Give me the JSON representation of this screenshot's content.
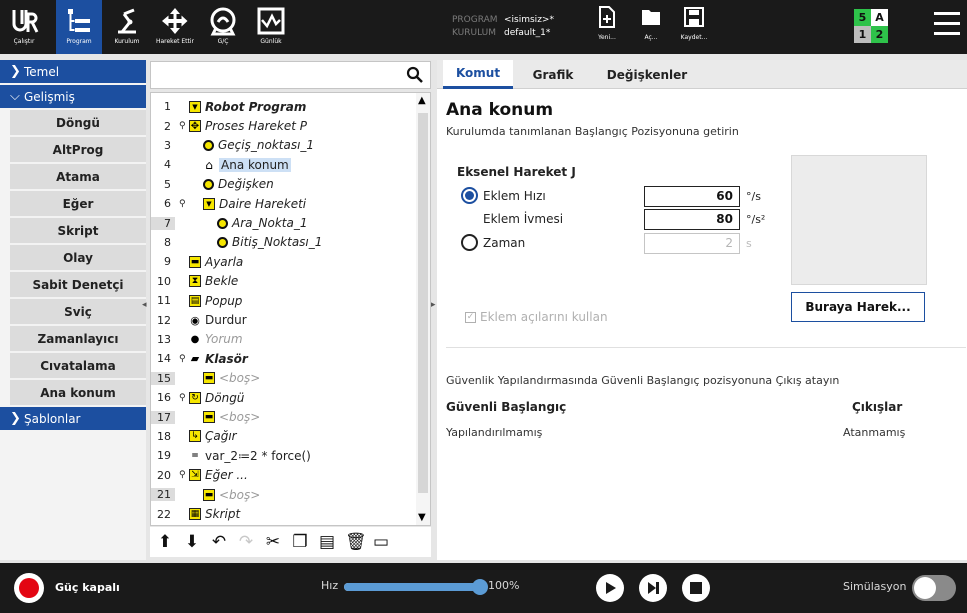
{
  "header": {
    "nav": [
      {
        "label": "Çalıştır",
        "icon": "run-icon"
      },
      {
        "label": "Program",
        "icon": "program-icon"
      },
      {
        "label": "Kurulum",
        "icon": "installation-icon"
      },
      {
        "label": "Hareket Ettir",
        "icon": "move-icon"
      },
      {
        "label": "G/Ç",
        "icon": "io-icon"
      },
      {
        "label": "Günlük",
        "icon": "log-icon"
      }
    ],
    "program_key": "PROGRAM",
    "program_value": "<isimsiz>*",
    "installation_key": "KURULUM",
    "installation_value": "default_1*",
    "file_buttons": [
      {
        "label": "Yeni...",
        "icon": "new-file-icon"
      },
      {
        "label": "Aç...",
        "icon": "open-folder-icon"
      },
      {
        "label": "Kaydet...",
        "icon": "save-icon"
      }
    ],
    "speed_grid": [
      "5",
      "A",
      "1",
      "2"
    ],
    "accent": "#1c4fa0"
  },
  "sidebar": {
    "basic_label": "Temel",
    "advanced_label": "Gelişmiş",
    "templates_label": "Şablonlar",
    "items": [
      "Döngü",
      "AltProg",
      "Atama",
      "Eğer",
      "Skript",
      "Olay",
      "Sabit Denetçi",
      "Sviç",
      "Zamanlayıcı",
      "Cıvatalama",
      "Ana konum"
    ]
  },
  "tree": {
    "rows": [
      {
        "n": "1",
        "text": "Robot Program",
        "icon": "yellow-triangle",
        "indent": 0,
        "pin": false,
        "style": "bold"
      },
      {
        "n": "2",
        "text": "Proses Hareket P",
        "icon": "move-cross",
        "indent": 0,
        "pin": true,
        "style": "italic"
      },
      {
        "n": "3",
        "text": "Geçiş_noktası_1",
        "icon": "waypoint",
        "indent": 1,
        "pin": false,
        "style": "italic"
      },
      {
        "n": "4",
        "text": "Ana konum",
        "icon": "home",
        "indent": 1,
        "pin": false,
        "style": "selected"
      },
      {
        "n": "5",
        "text": "Değişken",
        "icon": "waypoint",
        "indent": 1,
        "pin": false,
        "style": "italic"
      },
      {
        "n": "6",
        "text": "Daire Hareketi",
        "icon": "yellow-triangle",
        "indent": 1,
        "pin": true,
        "style": "italic"
      },
      {
        "n": "7",
        "text": "Ara_Nokta_1",
        "icon": "waypoint",
        "indent": 2,
        "pin": false,
        "style": "italic"
      },
      {
        "n": "8",
        "text": "Bitiş_Noktası_1",
        "icon": "waypoint",
        "indent": 2,
        "pin": false,
        "style": "italic"
      },
      {
        "n": "9",
        "text": "Ayarla",
        "icon": "yellow-dash",
        "indent": 0,
        "pin": false,
        "style": "italic"
      },
      {
        "n": "10",
        "text": "Bekle",
        "icon": "hourglass",
        "indent": 0,
        "pin": false,
        "style": "italic"
      },
      {
        "n": "11",
        "text": "Popup",
        "icon": "popup",
        "indent": 0,
        "pin": false,
        "style": "italic"
      },
      {
        "n": "12",
        "text": "Durdur",
        "icon": "stop",
        "indent": 0,
        "pin": false,
        "style": "plain"
      },
      {
        "n": "13",
        "text": "Yorum",
        "icon": "comment",
        "indent": 0,
        "pin": false,
        "style": "grey"
      },
      {
        "n": "14",
        "text": "Klasör",
        "icon": "folder",
        "indent": 0,
        "pin": true,
        "style": "bold"
      },
      {
        "n": "15",
        "text": "<boş>",
        "icon": "yellow-dash",
        "indent": 1,
        "pin": false,
        "style": "grey"
      },
      {
        "n": "16",
        "text": "Döngü",
        "icon": "loop",
        "indent": 0,
        "pin": true,
        "style": "italic"
      },
      {
        "n": "17",
        "text": "<boş>",
        "icon": "yellow-dash",
        "indent": 1,
        "pin": false,
        "style": "grey"
      },
      {
        "n": "18",
        "text": "Çağır",
        "icon": "call",
        "indent": 0,
        "pin": false,
        "style": "italic"
      },
      {
        "n": "19",
        "text": "var_2≔2 * force()",
        "icon": "assign",
        "indent": 0,
        "pin": false,
        "style": "plain"
      },
      {
        "n": "20",
        "text": "Eğer ...",
        "icon": "if",
        "indent": 0,
        "pin": true,
        "style": "italic"
      },
      {
        "n": "21",
        "text": "<boş>",
        "icon": "yellow-dash",
        "indent": 1,
        "pin": false,
        "style": "grey"
      },
      {
        "n": "22",
        "text": "Skript",
        "icon": "script",
        "indent": 0,
        "pin": false,
        "style": "italic"
      }
    ]
  },
  "tabs": [
    "Komut",
    "Grafik",
    "Değişkenler"
  ],
  "command": {
    "title": "Ana konum",
    "subtitle": "Kurulumda tanımlanan Başlangıç Pozisyonuna getirin",
    "movej_title": "Eksenel Hareket J",
    "joint_speed_label": "Eklem Hızı",
    "joint_speed_value": "60",
    "joint_speed_unit": "°/s",
    "joint_accel_label": "Eklem İvmesi",
    "joint_accel_value": "80",
    "joint_accel_unit": "°/s²",
    "time_label": "Zaman",
    "time_value": "2",
    "time_unit": "s",
    "move_here_label": "Buraya Harek...",
    "use_joint_angles_label": "Eklem açılarını kullan",
    "safe_description": "Güvenlik Yapılandırmasında Güvenli Başlangıç pozisyonuna Çıkış atayın",
    "safe_home_header": "Güvenli Başlangıç",
    "outputs_header": "Çıkışlar",
    "safe_home_value": "Yapılandırılmamış",
    "outputs_value": "Atanmamış"
  },
  "footer": {
    "power_label": "Güç kapalı",
    "speed_label": "Hız",
    "speed_value": "100%",
    "speed_fraction": 1.0,
    "simulation_label": "Simülasyon"
  }
}
